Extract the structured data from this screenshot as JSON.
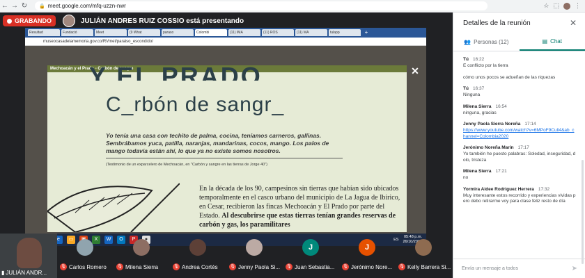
{
  "browser": {
    "url": "meet.google.com/mfq-uzzn-nwr",
    "icons": [
      "back-icon",
      "forward-icon",
      "reload-icon",
      "star-icon",
      "extensions-icon"
    ]
  },
  "presenting": {
    "recording_label": "GRABANDO",
    "presenter_text": "JULIÁN ANDRES RUIZ COSSIO está presentando"
  },
  "shared": {
    "tabs": [
      "Resultad",
      "Fundació",
      "Meet",
      "(9 What",
      "paraso",
      "Colombi",
      "(11) IMA",
      "(11) ROS",
      "(11) MA",
      "tulapp"
    ],
    "url": "museocasadelamemoria.gov.co/RVmet/paraiso_escondido/",
    "modal_header": "Mechoacán y el Prado - Carbón de sangre",
    "title_top": "Y EL PRADO",
    "title": "C_rbón de sangr_",
    "quote": "Yo tenía una casa con techito de palma, cocina, teníamos carneros, gallinas. Sembrábamos yuca, patilla, naranjas, mandarinas, cocos, mango. Los palos de mango todavía están ahí, lo que ya no existe somos nosotros.",
    "caption": "(Testimonio de un exparcelero de Mechoacán, en \"Carbón y sangre en las tierras de Jorge 40\")",
    "body_plain": "En la década de los 90, campesinos sin tierras que habían sido ubicados temporalmente en el casco urbano del municipio de La Jagua de Ibirico, en Cesar, recibieron las fincas Mechoacán y El Prado por parte del Estado. ",
    "body_bold": "Al descubrirse que estas tierras tenían grandes reservas de carbón y gas, los paramilitares",
    "close": "✕",
    "taskbar_lang": "ES",
    "time": "05:48 p.m.",
    "date": "26/10/2020"
  },
  "participants": {
    "self": "JULIÁN ANDR...",
    "others": [
      {
        "name": "Carlos Romero",
        "initial": "",
        "color": "#90a4ae"
      },
      {
        "name": "Milena Sierra",
        "initial": "",
        "color": "#8d6e63"
      },
      {
        "name": "Andrea Cortés",
        "initial": "",
        "color": "#5d4037"
      },
      {
        "name": "Jenny Paola Si...",
        "initial": "",
        "color": "#bcaaa4"
      },
      {
        "name": "Juan Sebastia...",
        "initial": "J",
        "color": "#00897b"
      },
      {
        "name": "Jerónimo Nore...",
        "initial": "J",
        "color": "#e65100"
      },
      {
        "name": "Kelly Barrera Si...",
        "initial": "",
        "color": "#8e6b50"
      }
    ]
  },
  "panel": {
    "title": "Detalles de la reunión",
    "tab_people": "Personas (12)",
    "tab_chat": "Chat",
    "input_placeholder": "Envía un mensaje a todos",
    "messages": [
      {
        "who": "",
        "time": "",
        "text": "E conflicto por la tierra"
      },
      {
        "who": "",
        "time": "",
        "text": "cómo unos pocos se adueñan de las riquezas"
      },
      {
        "who": "Tú",
        "time": "16:37",
        "text": "Ninguna"
      },
      {
        "who": "Milena Sierra",
        "time": "16:54",
        "text": "ninguna, gracias"
      },
      {
        "who": "Jenny Paola Sierra Noreña",
        "time": "17:14",
        "text": "https://www.youtube.com/watch?v=6MPoF9Cull4&ab_channel=Colombia2020"
      },
      {
        "who": "Jerónimo Noreña Marín",
        "time": "17:17",
        "text": "Yo también he puesto palabras: Soledad, inseguridad, dolo, tristeza"
      },
      {
        "who": "Milena Sierra",
        "time": "17:21",
        "text": "no"
      },
      {
        "who": "Yormira Aidee Rodriguez Herrera",
        "time": "17:32",
        "text": "Muy interesante estos recorrido y experiencias vividas pero debo retirarme voy para clase feliz resto de día"
      }
    ],
    "first_msg_who": "Tú",
    "first_msg_time": "16:22"
  }
}
